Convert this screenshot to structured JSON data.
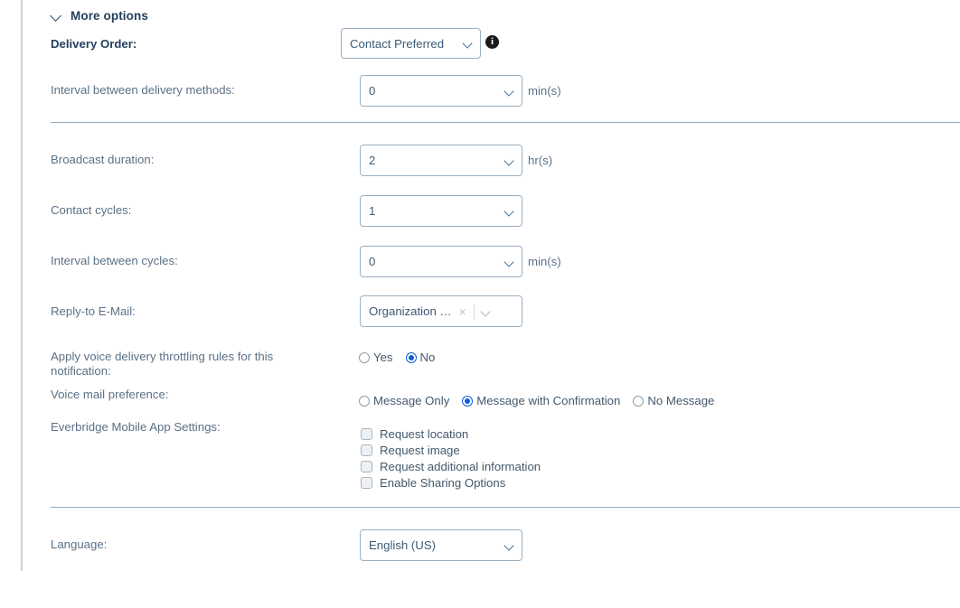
{
  "section": {
    "header_label": "More options",
    "chevron_icon": "chevron-down-icon"
  },
  "fields": {
    "delivery_order": {
      "label": "Delivery Order:",
      "value": "Contact Preferred",
      "info_icon": "info-icon",
      "info_glyph": "i"
    },
    "interval_between_delivery_methods": {
      "label": "Interval between delivery methods:",
      "value": "0",
      "unit": "min(s)"
    },
    "broadcast_duration": {
      "label": "Broadcast duration:",
      "value": "2",
      "unit": "hr(s)"
    },
    "contact_cycles": {
      "label": "Contact cycles:",
      "value": "1",
      "unit": ""
    },
    "interval_between_cycles": {
      "label": "Interval between cycles:",
      "value": "0",
      "unit": "min(s)"
    },
    "reply_to_email": {
      "label": "Reply-to E-Mail:",
      "value": "Organization …",
      "clear_glyph": "×",
      "clear_icon": "clear-icon",
      "chevron_icon": "chevron-down-icon"
    },
    "voice_throttling": {
      "label": "Apply voice delivery throttling rules for this notification:",
      "options": [
        {
          "label": "Yes",
          "selected": false
        },
        {
          "label": "No",
          "selected": true
        }
      ]
    },
    "voice_mail_preference": {
      "label": "Voice mail preference:",
      "options": [
        {
          "label": "Message Only",
          "selected": false
        },
        {
          "label": "Message with Confirmation",
          "selected": true
        },
        {
          "label": "No Message",
          "selected": false
        }
      ]
    },
    "mobile_app_settings": {
      "label": "Everbridge Mobile App Settings:",
      "options": [
        {
          "label": "Request location",
          "checked": false
        },
        {
          "label": "Request image",
          "checked": false
        },
        {
          "label": "Request additional information",
          "checked": false
        },
        {
          "label": "Enable Sharing Options",
          "checked": false
        }
      ]
    },
    "language": {
      "label": "Language:",
      "value": "English (US)"
    }
  },
  "colors": {
    "label": "#5b7188",
    "label_bold": "#24405c",
    "border": "#9bb0c2",
    "divider": "#94adbf",
    "accent": "#0b5fd7",
    "rail": "#c9d4dc"
  }
}
